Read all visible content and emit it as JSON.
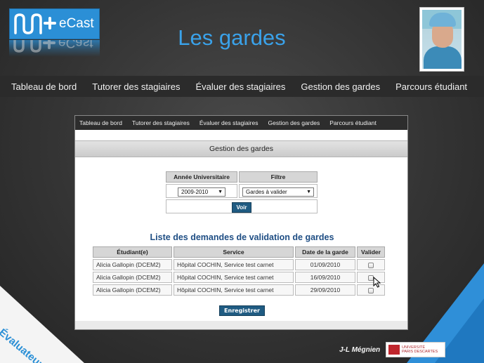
{
  "logo": {
    "brand": "eCast"
  },
  "slide": {
    "title": "Les gardes"
  },
  "top_nav": {
    "items": [
      "Tableau de bord",
      "Tutorer des stagiaires",
      "Évaluer des stagiaires",
      "Gestion des gardes",
      "Parcours étudiant"
    ]
  },
  "app": {
    "nav": {
      "items": [
        "Tableau de bord",
        "Tutorer des stagiaires",
        "Évaluer des stagiaires",
        "Gestion des gardes",
        "Parcours étudiant"
      ]
    },
    "section_title": "Gestion des gardes",
    "filters": {
      "year_header": "Année Universitaire",
      "filter_header": "Filtre",
      "year_value": "2009-2010",
      "filter_value": "Gardes à valider",
      "submit_label": "Voir"
    },
    "list": {
      "title": "Liste des demandes de validation de gardes",
      "headers": [
        "Étudiant(e)",
        "Service",
        "Date de la garde",
        "Valider"
      ],
      "rows": [
        {
          "student": "Alicia Gallopin (DCEM2)",
          "service": "Hôpital COCHIN, Service test carnet",
          "date": "01/09/2010"
        },
        {
          "student": "Alicia Gallopin (DCEM2)",
          "service": "Hôpital COCHIN, Service test carnet",
          "date": "16/09/2010"
        },
        {
          "student": "Alicia Gallopin (DCEM2)",
          "service": "Hôpital COCHIN, Service test carnet",
          "date": "29/09/2010"
        }
      ]
    },
    "save_label": "Enregistrer"
  },
  "corner_label": "Évaluateur",
  "footer": {
    "author": "J-L Mégnien",
    "university_line1": "UNIVERSITÉ",
    "university_line2": "PARIS DESCARTES"
  },
  "colors": {
    "title_blue": "#3aa2ea",
    "button_blue": "#1f5b82",
    "list_title_blue": "#1f4e84",
    "corner_blue": "#2f8fd8"
  }
}
